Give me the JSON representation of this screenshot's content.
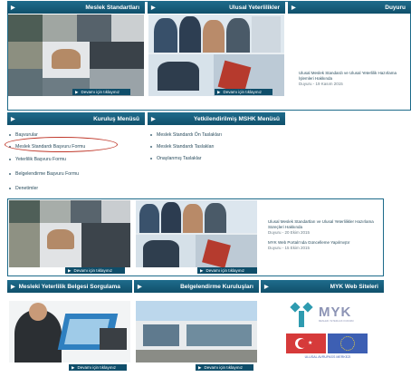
{
  "top_banners": {
    "meslek": {
      "title": "Meslek Standartları",
      "more": "Devamı için tıklayınız"
    },
    "ulusal": {
      "title": "Ulusal Yeterlilikler",
      "more": "Devamı için tıklayınız"
    },
    "duyuru": {
      "title": "Duyuru",
      "item_title": "Ulusal Meslek Standardı ve Ulusal Yeterlilik Hazırlama İşlemleri Hakkında",
      "item_date": "Duyuru - 19 Kasım 2015"
    }
  },
  "kurulus_menu": {
    "title": "Kuruluş Menüsü",
    "items": [
      "Başvurular",
      "Meslek Standardı Başvuru Formu",
      "Yeterlilik Başvuru Formu",
      "Belgelendirme Başvuru Formu",
      "Denetimler"
    ]
  },
  "yetki_menu": {
    "title": "Yetkilendirilmiş MSHK Menüsü",
    "items": [
      "Meslek Standardı Ön Taslakları",
      "Meslek Standardı Taslakları",
      "Onaylanmış Taslaklar"
    ]
  },
  "middle": {
    "more1": "Devamı için tıklayınız",
    "more2": "Devamı için tıklayınız",
    "news1": "Ulusal Meslek Standartları ve Ulusal Yeterlilikler Hazırlama Süreçleri Hakkında",
    "news1_date": "Duyuru - 20 Ekim 2015",
    "news2": "MYK Web Portalı'nda Güncelleme Yapılmıştır",
    "news2_date": "Duyuru - 15 Ekim 2015"
  },
  "bottom_bars": {
    "b1": "Mesleki Yeterlilik Belgesi Sorgulama",
    "b2": "Belgelendirme Kuruluşları",
    "b3": "MYK Web Siteleri"
  },
  "bottom": {
    "more1": "Devamı için tıklayınız",
    "more2": "Devamı için tıklayınız",
    "myk_logo_text": "MYK",
    "myk_sub": "MESLEKİ YETERLİLİK KURUMU",
    "eu_caption": "ULUSAL AVRUPASS MERKEZİ"
  },
  "colors": {
    "accent": "#1c6a8a",
    "header_dark": "#10506b",
    "highlight_ring": "#c0392b"
  }
}
